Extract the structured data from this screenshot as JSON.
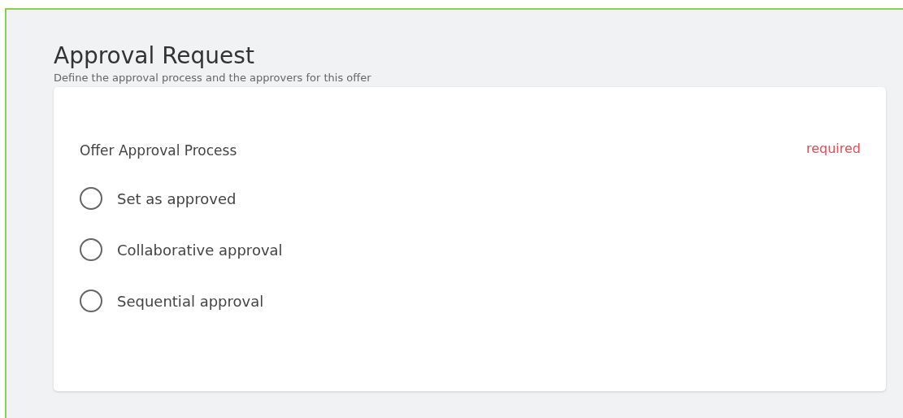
{
  "header": {
    "title": "Approval Request",
    "subtitle": "Define the approval process and the approvers for this offer"
  },
  "field": {
    "label": "Offer Approval Process",
    "required_note": "required",
    "options": [
      {
        "label": "Set as approved",
        "selected": false
      },
      {
        "label": "Collaborative approval",
        "selected": false
      },
      {
        "label": "Sequential approval",
        "selected": false
      }
    ]
  }
}
